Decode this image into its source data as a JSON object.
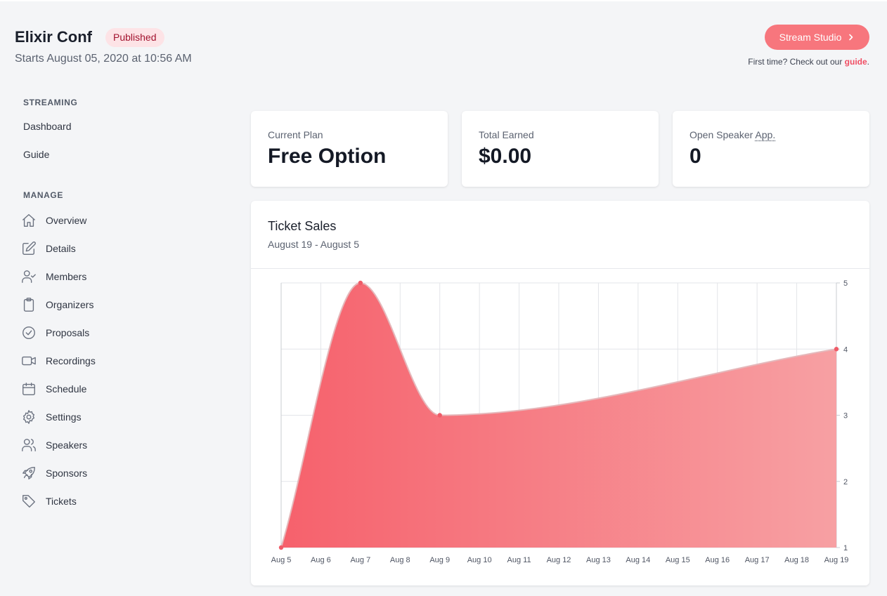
{
  "header": {
    "title": "Elixir Conf",
    "status_badge": "Published",
    "start_text": "Starts August 05, 2020 at 10:56 AM",
    "stream_button": "Stream Studio",
    "guide_text_prefix": "First time? Check out our ",
    "guide_link": "guide",
    "guide_text_suffix": "."
  },
  "sidebar": {
    "streaming_label": "STREAMING",
    "streaming_items": [
      {
        "label": "Dashboard"
      },
      {
        "label": "Guide"
      }
    ],
    "manage_label": "MANAGE",
    "manage_items": [
      {
        "label": "Overview",
        "icon": "home-icon"
      },
      {
        "label": "Details",
        "icon": "edit-icon"
      },
      {
        "label": "Members",
        "icon": "user-check-icon"
      },
      {
        "label": "Organizers",
        "icon": "clipboard-icon"
      },
      {
        "label": "Proposals",
        "icon": "check-circle-icon"
      },
      {
        "label": "Recordings",
        "icon": "video-icon"
      },
      {
        "label": "Schedule",
        "icon": "calendar-icon"
      },
      {
        "label": "Settings",
        "icon": "gear-icon"
      },
      {
        "label": "Speakers",
        "icon": "users-icon"
      },
      {
        "label": "Sponsors",
        "icon": "rocket-icon"
      },
      {
        "label": "Tickets",
        "icon": "tag-icon"
      }
    ]
  },
  "stats": {
    "plan_label": "Current Plan",
    "plan_value": "Free Option",
    "earned_label": "Total Earned",
    "earned_value": "$0.00",
    "speaker_label_main": "Open Speaker ",
    "speaker_label_abbr": "App.",
    "speaker_value": "0"
  },
  "chart_card": {
    "title": "Ticket Sales",
    "subtitle": "August 19 - August 5"
  },
  "colors": {
    "accent": "#f7767d",
    "badge_bg": "#fde3e6",
    "badge_text": "#a2122e",
    "link": "#f04e64",
    "area_start": "#f6616c",
    "area_end": "#f7a0a3"
  },
  "chart_data": {
    "type": "area",
    "categories": [
      "Aug 5",
      "Aug 6",
      "Aug 7",
      "Aug 8",
      "Aug 9",
      "Aug 10",
      "Aug 11",
      "Aug 12",
      "Aug 13",
      "Aug 14",
      "Aug 15",
      "Aug 16",
      "Aug 17",
      "Aug 18",
      "Aug 19"
    ],
    "points": [
      {
        "x": "Aug 5",
        "y": 1
      },
      {
        "x": "Aug 7",
        "y": 5
      },
      {
        "x": "Aug 9",
        "y": 3
      },
      {
        "x": "Aug 19",
        "y": 4
      }
    ],
    "ylim": [
      1,
      5
    ],
    "yticks": [
      1,
      2,
      3,
      4,
      5
    ],
    "y_axis_side": "right",
    "grid": true,
    "legend": "none",
    "curve": "smooth",
    "fill": "horizontal gradient"
  }
}
